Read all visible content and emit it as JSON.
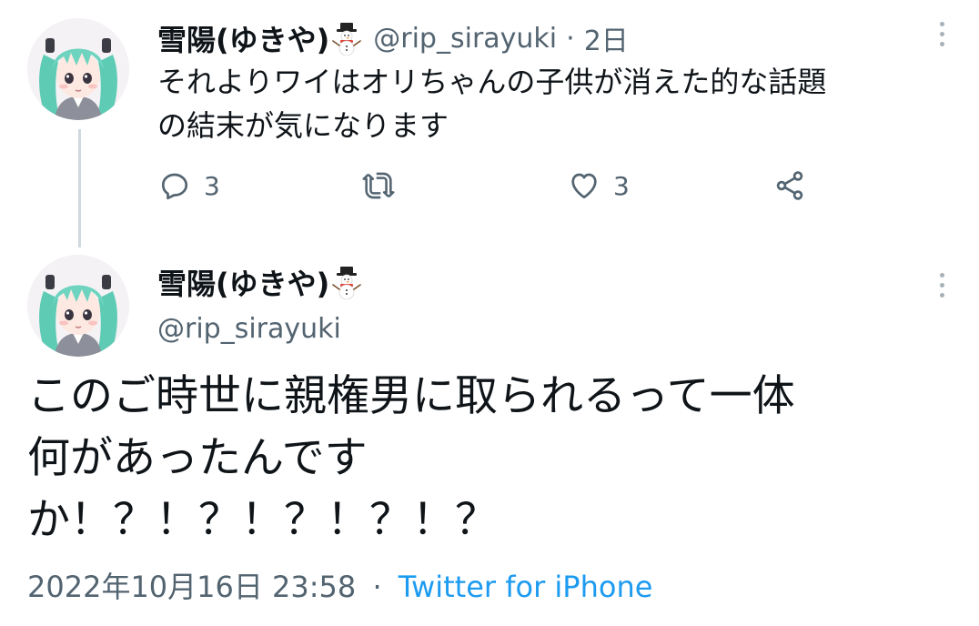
{
  "tweets": [
    {
      "display_name": "雪陽(ゆきや)",
      "handle": "@rip_sirayuki",
      "separator": "·",
      "time_ago": "2日",
      "text_lines": [
        "それよりワイはオリちゃんの子供が消えた的な話題",
        "の結末が気になります"
      ],
      "actions": {
        "reply_count": "3",
        "like_count": "3"
      },
      "icons": [
        "avatar",
        "snowman-emoji-icon",
        "more-options-icon",
        "reply-icon",
        "retweet-icon",
        "like-icon",
        "share-icon"
      ]
    },
    {
      "display_name": "雪陽(ゆきや)",
      "handle": "@rip_sirayuki",
      "text_lines": [
        "このご時世に親権男に取られるって一体",
        "何があったんです",
        "か！？！？！？！？！？"
      ],
      "timestamp": "2022年10月16日 23:58",
      "separator": "·",
      "source": "Twitter for iPhone"
    }
  ],
  "colors": {
    "text": "#0f1419",
    "secondary": "#536471",
    "link": "#1d9bf0",
    "thread_line": "#cfd9de"
  }
}
